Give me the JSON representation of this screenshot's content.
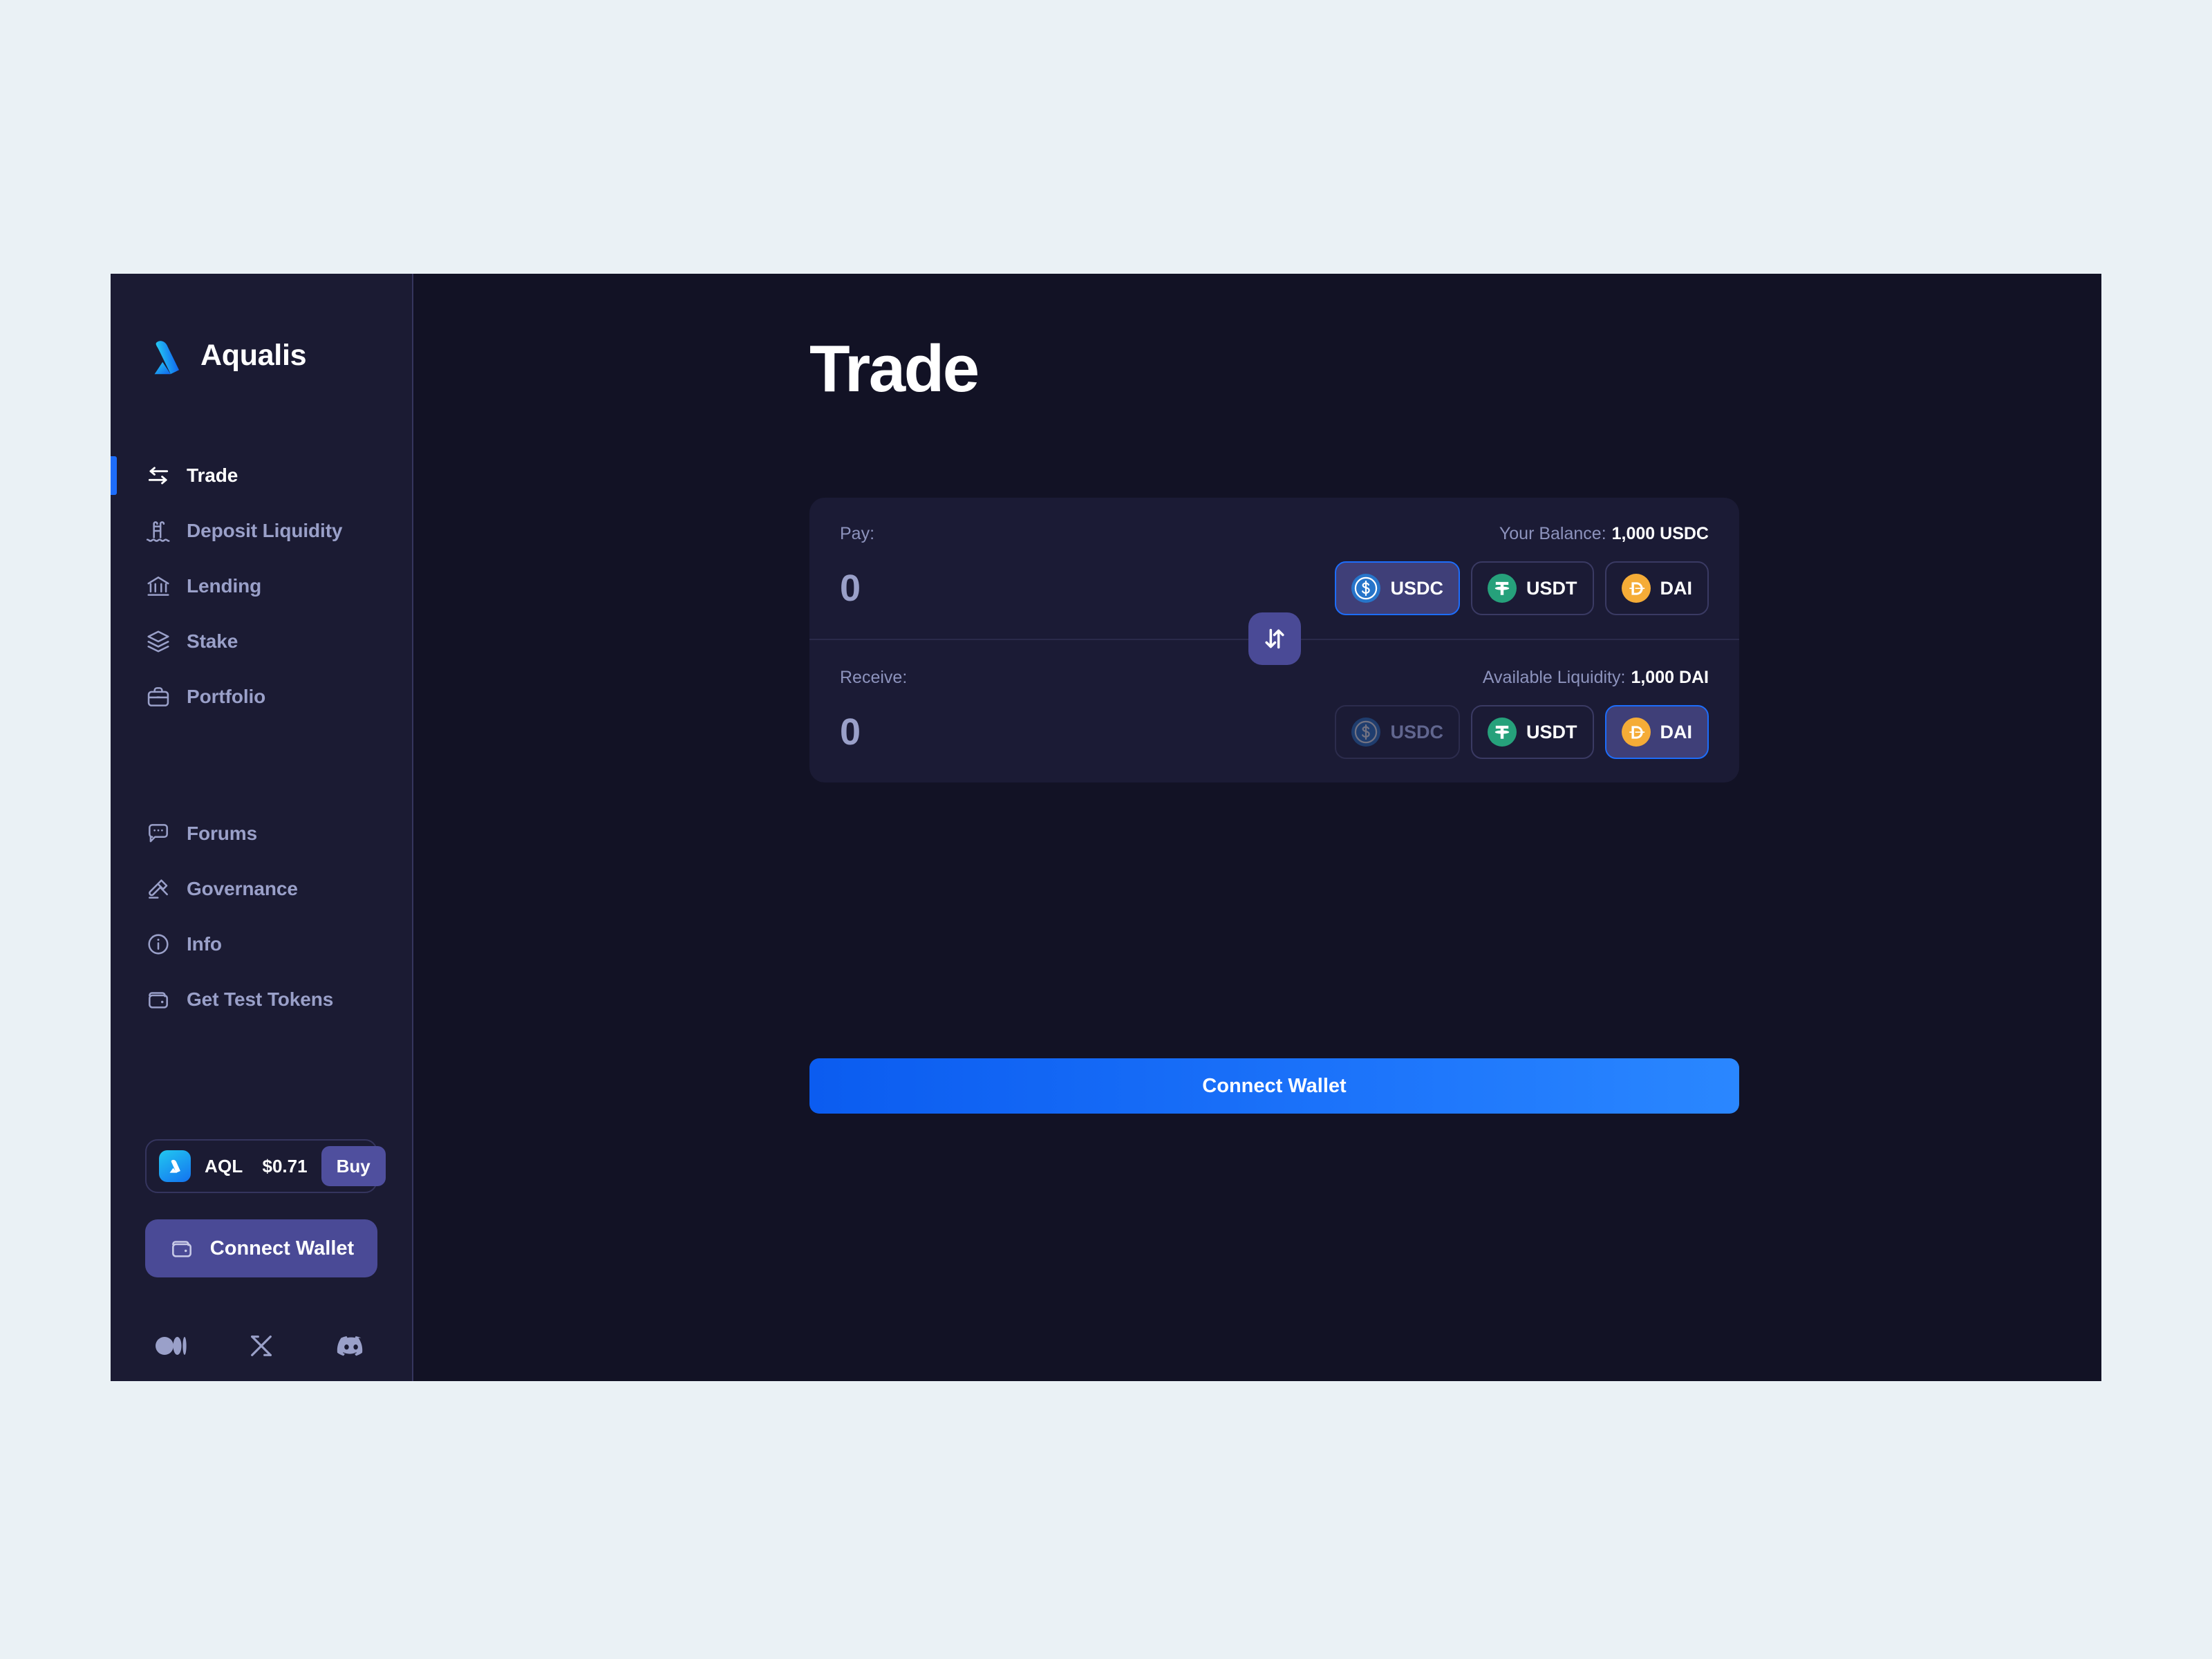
{
  "brand": {
    "name": "Aqualis",
    "logo_icon": "aqualis-logo-icon"
  },
  "sidebar": {
    "nav_primary": [
      {
        "label": "Trade",
        "icon": "swap-arrows-icon",
        "active": true
      },
      {
        "label": "Deposit Liquidity",
        "icon": "pool-ladder-icon",
        "active": false
      },
      {
        "label": "Lending",
        "icon": "bank-icon",
        "active": false
      },
      {
        "label": "Stake",
        "icon": "layers-icon",
        "active": false
      },
      {
        "label": "Portfolio",
        "icon": "briefcase-icon",
        "active": false
      }
    ],
    "nav_secondary": [
      {
        "label": "Forums",
        "icon": "chat-bubble-icon"
      },
      {
        "label": "Governance",
        "icon": "gavel-icon"
      },
      {
        "label": "Info",
        "icon": "info-circle-icon"
      },
      {
        "label": "Get Test Tokens",
        "icon": "wallet-icon"
      }
    ],
    "token_widget": {
      "symbol": "AQL",
      "price": "$0.71",
      "buy_label": "Buy",
      "logo_icon": "aql-token-icon"
    },
    "connect_wallet_label": "Connect Wallet",
    "connect_wallet_icon": "wallet-icon",
    "socials": [
      {
        "name": "medium",
        "icon": "medium-icon"
      },
      {
        "name": "x",
        "icon": "x-twitter-icon"
      },
      {
        "name": "discord",
        "icon": "discord-icon"
      }
    ]
  },
  "main": {
    "page_title": "Trade",
    "pay": {
      "label": "Pay:",
      "meta_label": "Your Balance:",
      "meta_value": "1,000 USDC",
      "amount_value": "0",
      "amount_placeholder": "0",
      "tokens": [
        {
          "symbol": "USDC",
          "icon": "usdc-icon",
          "state": "selected"
        },
        {
          "symbol": "USDT",
          "icon": "usdt-icon",
          "state": "enabled"
        },
        {
          "symbol": "DAI",
          "icon": "dai-icon",
          "state": "enabled"
        }
      ]
    },
    "swap_icon": "swap-vertical-icon",
    "receive": {
      "label": "Receive:",
      "meta_label": "Available Liquidity:",
      "meta_value": "1,000 DAI",
      "amount_value": "0",
      "amount_placeholder": "0",
      "tokens": [
        {
          "symbol": "USDC",
          "icon": "usdc-icon",
          "state": "disabled"
        },
        {
          "symbol": "USDT",
          "icon": "usdt-icon",
          "state": "enabled"
        },
        {
          "symbol": "DAI",
          "icon": "dai-icon",
          "state": "selected"
        }
      ]
    },
    "cta_label": "Connect Wallet"
  },
  "colors": {
    "page_bg": "#eaf1f5",
    "app_bg": "#121225",
    "sidebar_bg": "#1b1b33",
    "card_bg": "#1b1b35",
    "accent_blue": "#1d6dfb",
    "accent_purple": "#4a4a96",
    "muted_text": "#8d93bd",
    "usdc": "#2775ca",
    "usdt": "#26a17b",
    "dai": "#f5ac37"
  }
}
